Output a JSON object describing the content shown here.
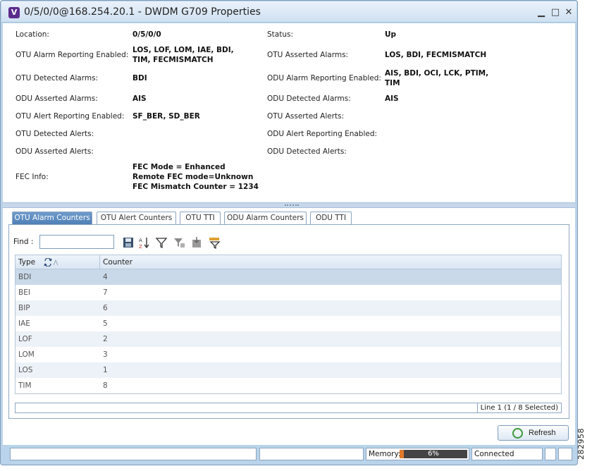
{
  "window": {
    "app_icon_letter": "V",
    "title": "0/5/0/0@168.254.20.1 - DWDM G709 Properties",
    "minimize_glyph": "▁",
    "maximize_glyph": "□",
    "close_glyph": "✕"
  },
  "properties": {
    "location_label": "Location:",
    "location_value": "0/5/0/0",
    "status_label": "Status:",
    "status_value": "Up",
    "otu_alarm_reporting_label": "OTU Alarm Reporting Enabled:",
    "otu_alarm_reporting_value_1": "LOS, LOF, LOM, IAE, BDI,",
    "otu_alarm_reporting_value_2": "TIM, FECMISMATCH",
    "otu_asserted_alarms_label": "OTU Asserted Alarms:",
    "otu_asserted_alarms_value": "LOS, BDI, FECMISMATCH",
    "otu_detected_alarms_label": "OTU Detected Alarms:",
    "otu_detected_alarms_value": "BDI",
    "odu_alarm_reporting_label": "ODU Alarm Reporting Enabled:",
    "odu_alarm_reporting_value_1": "AIS, BDI, OCI, LCK, PTIM,",
    "odu_alarm_reporting_value_2": "TIM",
    "odu_asserted_alarms_label": "ODU Asserted Alarms:",
    "odu_asserted_alarms_value": "AIS",
    "odu_detected_alarms_label": "ODU Detected Alarms:",
    "odu_detected_alarms_value": "AIS",
    "otu_alert_reporting_label": "OTU Alert Reporting Enabled:",
    "otu_alert_reporting_value": "SF_BER, SD_BER",
    "otu_asserted_alerts_label": "OTU Asserted Alerts:",
    "otu_detected_alerts_label": "OTU Detected Alerts:",
    "odu_alert_reporting_label": "ODU Alert Reporting Enabled:",
    "odu_asserted_alerts_label": "ODU Asserted Alerts:",
    "odu_detected_alerts_label": "ODU Detected Alerts:",
    "fec_info_label": "FEC Info:",
    "fec_info_line_1": "FEC Mode = Enhanced",
    "fec_info_line_2": "Remote FEC mode=Unknown",
    "fec_info_line_3": "FEC Mismatch Counter = 1234"
  },
  "tabs": [
    {
      "label": "OTU Alarm Counters",
      "active": true
    },
    {
      "label": "OTU Alert Counters",
      "active": false
    },
    {
      "label": "OTU TTI",
      "active": false
    },
    {
      "label": "ODU Alarm Counters",
      "active": false
    },
    {
      "label": "ODU TTI",
      "active": false
    }
  ],
  "toolbar": {
    "find_label": "Find :",
    "find_value": "",
    "icons": [
      "save-icon",
      "sort-icon",
      "filter-icon",
      "clear-filter-icon",
      "export-icon",
      "column-filter-icon"
    ]
  },
  "table": {
    "columns": [
      "Type",
      "Counter"
    ],
    "rows": [
      {
        "type": "BDI",
        "counter": "4"
      },
      {
        "type": "BEI",
        "counter": "7"
      },
      {
        "type": "BIP",
        "counter": "6"
      },
      {
        "type": "IAE",
        "counter": "5"
      },
      {
        "type": "LOF",
        "counter": "2"
      },
      {
        "type": "LOM",
        "counter": "3"
      },
      {
        "type": "LOS",
        "counter": "1"
      },
      {
        "type": "TIM",
        "counter": "8"
      }
    ],
    "selection_status": "Line 1 (1 / 8 Selected)"
  },
  "refresh_label": "Refresh",
  "status_bar": {
    "memory_label": "Memory:",
    "memory_text": "6%",
    "memory_fraction": 0.06,
    "connection": "Connected"
  },
  "figure_id": "282958",
  "colors": {
    "frame": "#b9d3ea",
    "active_tab": "#5a88bf",
    "selected_row": "#c9d9ea",
    "memory_fill": "#e07a2a"
  }
}
